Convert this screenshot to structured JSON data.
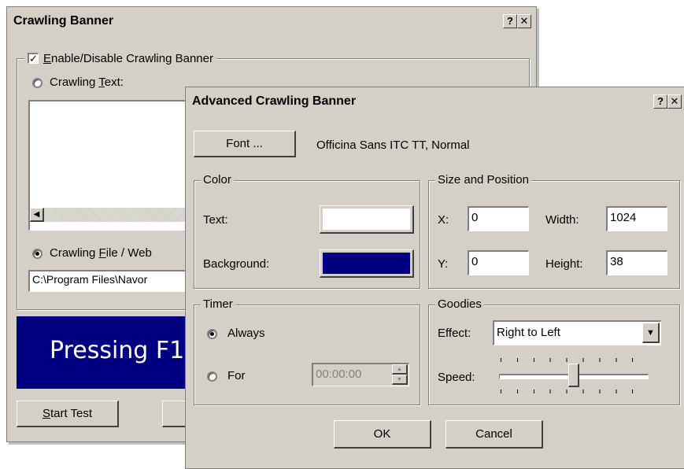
{
  "back_dialog": {
    "title": "Crawling Banner",
    "help_btn": "?",
    "close_btn": "✕",
    "enable_label_pre": "",
    "enable_label_ul": "E",
    "enable_label_post": "nable/Disable Crawling Banner",
    "crawling_text_pre": "Crawling ",
    "crawling_text_ul": "T",
    "crawling_text_post": "ext:",
    "crawling_file_pre": "Crawling ",
    "crawling_file_ul": "F",
    "crawling_file_post": "ile / Web",
    "file_path": "C:\\Program Files\\Navor",
    "preview_text": "Pressing F1",
    "start_test_ul": "S",
    "start_test_post": "tart Test"
  },
  "front_dialog": {
    "title": "Advanced Crawling Banner",
    "help_btn": "?",
    "close_btn": "✕",
    "font_button": "Font ...",
    "font_value": "Officina Sans ITC TT, Normal",
    "color_group": "Color",
    "text_label": "Text:",
    "background_label": "Background:",
    "text_color": "#ffffff",
    "background_color": "#000080",
    "size_group": "Size and Position",
    "x_label": "X:",
    "x_value": "0",
    "y_label": "Y:",
    "y_value": "0",
    "width_label": "Width:",
    "width_value": "1024",
    "height_label": "Height:",
    "height_value": "38",
    "timer_group": "Timer",
    "always_label": "Always",
    "for_label": "For",
    "time_value": "00:00:00",
    "goodies_group": "Goodies",
    "effect_label": "Effect:",
    "effect_value": "Right to Left",
    "speed_label": "Speed:",
    "speed_level": 0.5,
    "ok_button": "OK",
    "cancel_button": "Cancel"
  }
}
